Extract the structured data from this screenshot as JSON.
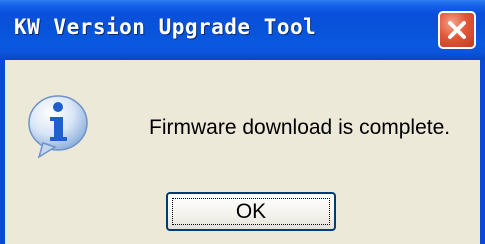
{
  "window": {
    "title": "KW Version Upgrade Tool",
    "close_icon": "close-icon"
  },
  "dialog": {
    "icon": "information-icon",
    "message": "Firmware download is complete.",
    "ok_label": "OK"
  },
  "colors": {
    "titlebar": "#0a4fdc",
    "close_button": "#e2573a",
    "dialog_background": "#ece9d8",
    "button_border": "#003c74",
    "icon_blue": "#1f5fcf"
  }
}
